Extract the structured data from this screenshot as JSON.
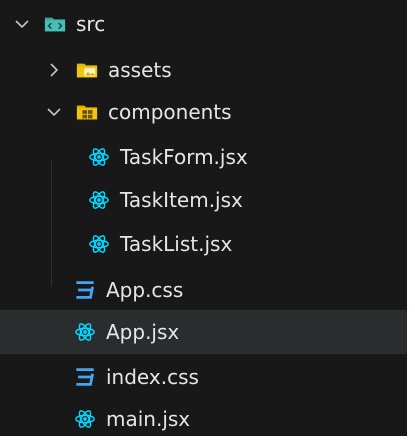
{
  "tree": [
    {
      "label": "src",
      "kind": "folder",
      "expanded": true,
      "icon": "src-folder-icon"
    },
    {
      "label": "assets",
      "kind": "folder",
      "expanded": false,
      "icon": "assets-folder-icon"
    },
    {
      "label": "components",
      "kind": "folder",
      "expanded": true,
      "icon": "components-folder-icon"
    },
    {
      "label": "TaskForm.jsx",
      "kind": "file",
      "icon": "react-icon"
    },
    {
      "label": "TaskItem.jsx",
      "kind": "file",
      "icon": "react-icon"
    },
    {
      "label": "TaskList.jsx",
      "kind": "file",
      "icon": "react-icon"
    },
    {
      "label": "App.css",
      "kind": "file",
      "icon": "css-icon"
    },
    {
      "label": "App.jsx",
      "kind": "file",
      "icon": "react-icon",
      "selected": true
    },
    {
      "label": "index.css",
      "kind": "file",
      "icon": "css-icon"
    },
    {
      "label": "main.jsx",
      "kind": "file",
      "icon": "react-icon"
    }
  ],
  "colors": {
    "background": "#181818",
    "selected": "#2a2d2e",
    "text": "#e6e6e6",
    "react": "#00d8ff",
    "css": "#42a5f5",
    "folder_yellow": "#f1c40f",
    "folder_teal": "#34c3b5"
  }
}
